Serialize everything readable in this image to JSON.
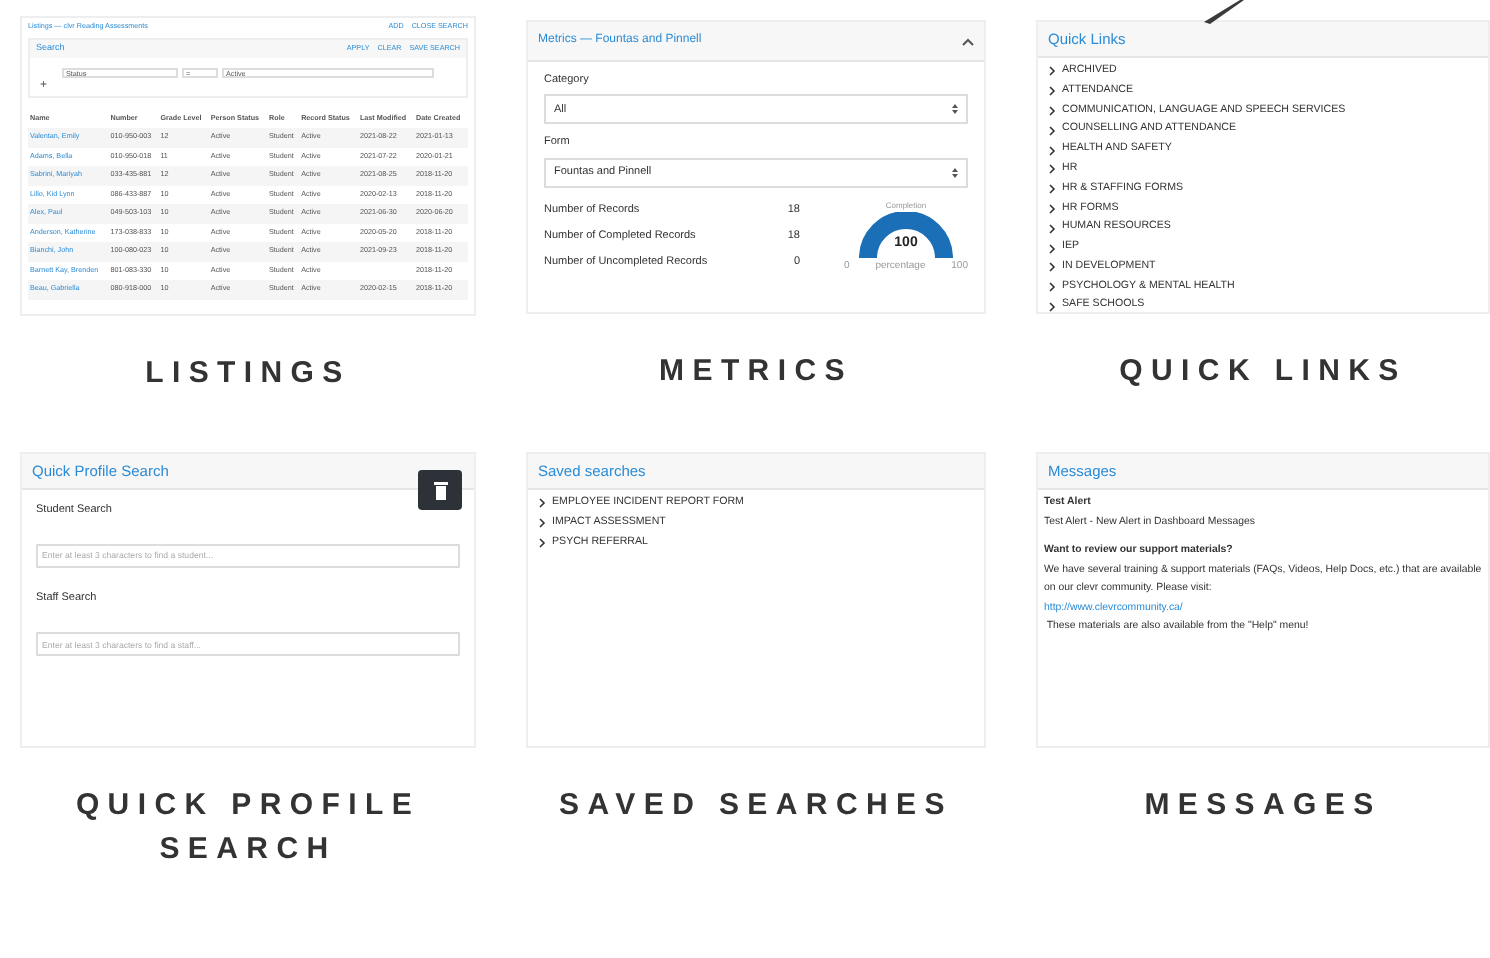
{
  "listings": {
    "title": "Listings — clvr Reading Assessments",
    "actions": [
      "ADD",
      "CLOSE SEARCH"
    ],
    "search": {
      "title": "Search",
      "actions": [
        "APPLY",
        "CLEAR",
        "SAVE SEARCH"
      ],
      "filter": [
        "Status",
        "=",
        "Active"
      ],
      "add": "+"
    },
    "columns": [
      "Name",
      "Number",
      "Grade Level",
      "Person Status",
      "Role",
      "Record Status",
      "Last Modified",
      "Date Created"
    ],
    "rows": [
      [
        "Valentan, Emily",
        "010-950-003",
        "12",
        "Active",
        "Student",
        "Active",
        "2021-08-22",
        "2021-01-13"
      ],
      [
        "Adams, Bella",
        "010-950-018",
        "11",
        "Active",
        "Student",
        "Active",
        "2021-07-22",
        "2020-01-21"
      ],
      [
        "Sabrini, Mariyah",
        "033-435-881",
        "12",
        "Active",
        "Student",
        "Active",
        "2021-08-25",
        "2018-11-20"
      ],
      [
        "Lillo, Kid Lynn",
        "086-433-887",
        "10",
        "Active",
        "Student",
        "Active",
        "2020-02-13",
        "2018-11-20"
      ],
      [
        "Alex, Paul",
        "049-503-103",
        "10",
        "Active",
        "Student",
        "Active",
        "2021-06-30",
        "2020-06-20"
      ],
      [
        "Anderson, Katherine",
        "173-038-833",
        "10",
        "Active",
        "Student",
        "Active",
        "2020-05-20",
        "2018-11-20"
      ],
      [
        "Bianchi, John",
        "100-080-023",
        "10",
        "Active",
        "Student",
        "Active",
        "2021-09-23",
        "2018-11-20"
      ],
      [
        "Barnett Kay, Brenden",
        "801-083-330",
        "10",
        "Active",
        "Student",
        "Active",
        "",
        "2018-11-20"
      ],
      [
        "Beau, Gabriella",
        "080-918-000",
        "10",
        "Active",
        "Student",
        "Active",
        "2020-02-15",
        "2018-11-20"
      ]
    ],
    "caption": "LISTINGS"
  },
  "metrics": {
    "title": "Metrics — Fountas and Pinnell",
    "fields": [
      {
        "label": "Category",
        "value": "All"
      },
      {
        "label": "Form",
        "value": "Fountas and Pinnell"
      }
    ],
    "stats": [
      {
        "label": "Number of Records",
        "value": "18"
      },
      {
        "label": "Number of Completed Records",
        "value": "18"
      },
      {
        "label": "Number of Uncompleted Records",
        "value": "0"
      }
    ],
    "gauge": {
      "title": "Completion",
      "value": "100",
      "unit": "percentage",
      "min": "0",
      "max": "100"
    },
    "caption": "METRICS"
  },
  "quick_links": {
    "title": "Quick Links",
    "items": [
      "ARCHIVED",
      "ATTENDANCE",
      "COMMUNICATION, LANGUAGE AND SPEECH SERVICES",
      "COUNSELLING AND ATTENDANCE",
      "HEALTH AND SAFETY",
      "HR",
      "HR & STAFFING FORMS",
      "HR FORMS",
      "HUMAN RESOURCES",
      "IEP",
      "IN DEVELOPMENT",
      "PSYCHOLOGY & MENTAL HEALTH",
      "SAFE SCHOOLS"
    ],
    "caption": "QUICK LINKS"
  },
  "quick_profile_search": {
    "title": "Quick Profile Search",
    "fields": [
      {
        "label": "Student Search",
        "placeholder": "Enter at least 3 characters to find a student..."
      },
      {
        "label": "Staff Search",
        "placeholder": "Enter at least 3 characters to find a staff..."
      }
    ],
    "caption": "QUICK PROFILE SEARCH"
  },
  "saved_searches": {
    "title": "Saved searches",
    "items": [
      "EMPLOYEE INCIDENT REPORT FORM",
      "IMPACT ASSESSMENT",
      "PSYCH REFERRAL"
    ],
    "caption": "SAVED SEARCHES"
  },
  "messages": {
    "title": "Messages",
    "blocks": [
      {
        "heading": "Test Alert",
        "lines": [
          "Test Alert - New Alert in Dashboard Messages"
        ]
      },
      {
        "heading": "Want to review our support materials?",
        "lines": [
          "We have several training & support materials (FAQs, Videos, Help Docs, etc.) that are available on our clevr community. Please visit:"
        ],
        "link": "http://www.clevrcommunity.ca/",
        "after": " These materials are also available from the \"Help\" menu!"
      }
    ],
    "caption": "MESSAGES"
  }
}
